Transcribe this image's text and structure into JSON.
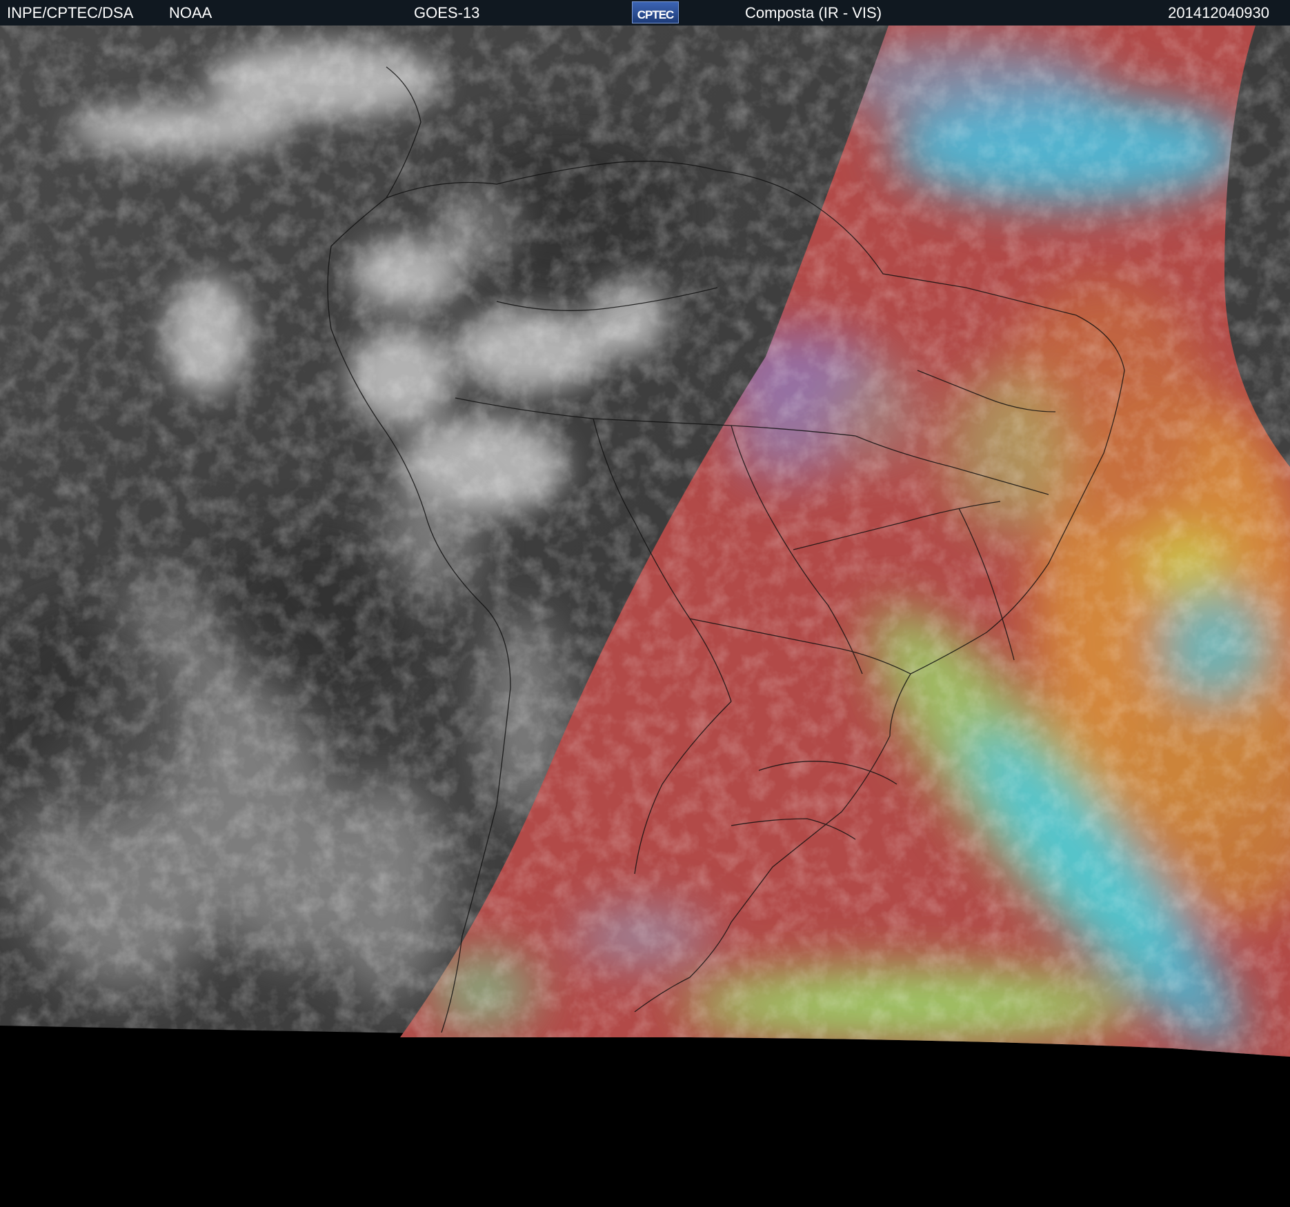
{
  "header": {
    "agency": "INPE/CPTEC/DSA",
    "source": "NOAA",
    "satellite": "GOES-13",
    "product": "Composta (IR - VIS)",
    "timestamp": "201412040930"
  },
  "logo": {
    "text": "CPTEC"
  },
  "colors": {
    "header_bg": "#101820",
    "ir_background": "#3f3f3f",
    "ir_clouds": "#d6d6d6",
    "vis_land_ocean": "#b24a48",
    "vis_ocean_warm": "#d58a3c",
    "vis_low_cloud": "#9ad86a",
    "vis_high_cloud": "#3ec7e8",
    "space": "#000000",
    "borders": "#111111"
  }
}
